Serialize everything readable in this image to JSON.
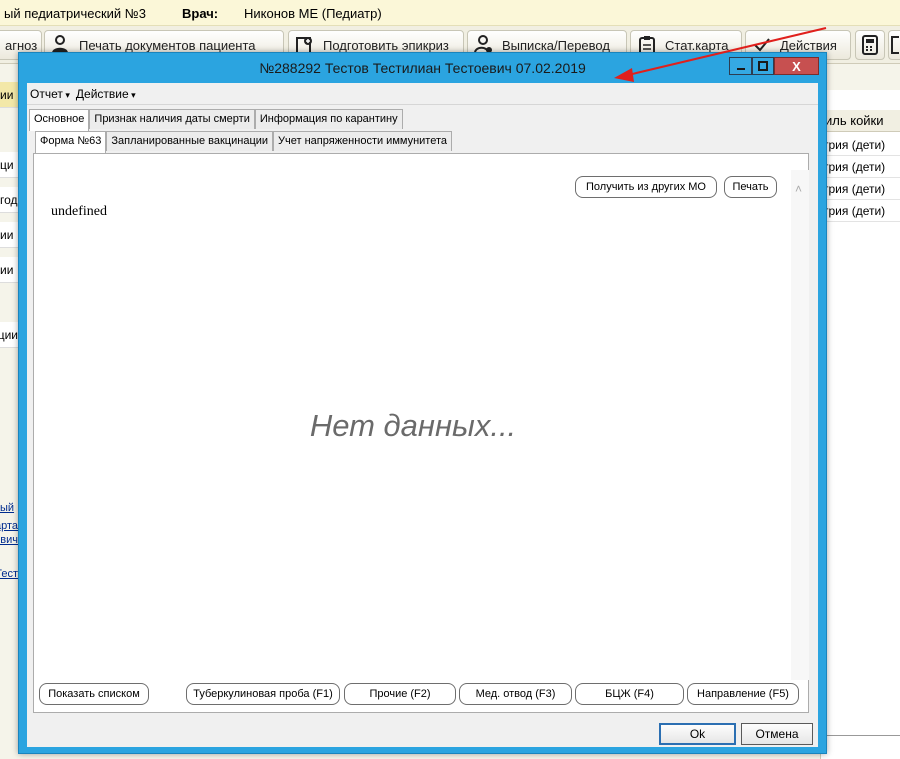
{
  "app": {
    "hospital": "ый педиатрический №3",
    "doctor_label": "Врач:",
    "doctor_name": "Никонов МЕ (Педиатр)",
    "toolbar": [
      {
        "label": "агноз",
        "icon": "diagnosis-icon"
      },
      {
        "label": "Печать документов пациента",
        "icon": "person-print-icon"
      },
      {
        "label": "Подготовить эпикриз",
        "icon": "document-prepare-icon"
      },
      {
        "label": "Выписка/Перевод",
        "icon": "person-transfer-icon"
      },
      {
        "label": "Стат.карта",
        "icon": "clipboard-icon"
      },
      {
        "label": "Действия",
        "icon": "checkmark-icon"
      }
    ],
    "left_rows": [
      "ии",
      "ци",
      "год",
      "ии",
      "ии",
      "ации"
    ],
    "left_links": [
      "ый",
      "арта",
      "тевич",
      "Тест"
    ],
    "right_header": "иль койки",
    "right_rows": [
      "трия (дети)",
      "трия (дети)",
      "трия (дети)",
      "трия (дети)"
    ]
  },
  "dialog": {
    "title": "№288292 Тестов Тестилиан Тестоевич 07.02.2019",
    "close_glyph": "X",
    "menu": [
      "Отчет",
      "Действие"
    ],
    "tabs_main": [
      "Основное",
      "Признак наличия даты смерти",
      "Информация по карантину"
    ],
    "tabs_sub": [
      "Форма №63",
      "Запланированные вакцинации",
      "Учет напряженности иммунитета"
    ],
    "undefined_text": "undefined",
    "get_from_mo": "Получить из других МО",
    "print": "Печать",
    "no_data": "Нет данных...",
    "bottom_buttons": {
      "show_list": "Показать списком",
      "tb_test": "Туберкулиновая проба (F1)",
      "other": "Прочие (F2)",
      "med_exempt": "Мед. отвод (F3)",
      "bcg": "БЦЖ (F4)",
      "referral": "Направление (F5)"
    },
    "ok": "Ok",
    "cancel": "Отмена"
  },
  "colors": {
    "window_frame": "#2ba4e0",
    "close_button": "#c75050",
    "annotation_arrow": "#e0201c"
  }
}
